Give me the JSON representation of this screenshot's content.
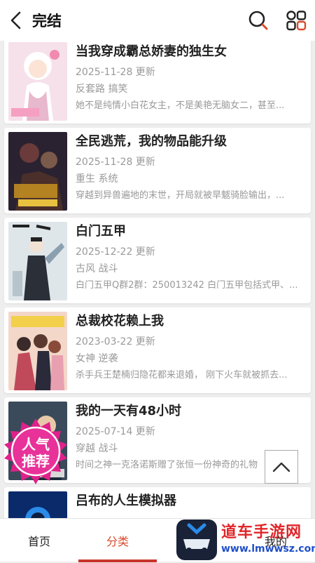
{
  "header": {
    "title": "完结",
    "back_icon": "chevron-left-icon",
    "search_icon": "search-icon",
    "menu_icon": "grid-menu-icon"
  },
  "comics": [
    {
      "title": "当我穿成霸总娇妻的独生女",
      "updated": "2025-11-28 更新",
      "tags": "反套路 搞笑",
      "desc": "她不是纯情小白花女主，不是美艳无脑女二，甚至..."
    },
    {
      "title": "全民逃荒，我的物品能升级",
      "updated": "2025-11-28 更新",
      "tags": "重生 系统",
      "desc": "穿越到异兽遍地的末世，开局就被旱魃骑脸输出，..."
    },
    {
      "title": "白门五甲",
      "updated": "2025-12-22 更新",
      "tags": "古风 战斗",
      "desc": "白门五甲Q群2群：250013242 白门五甲包括式甲、..."
    },
    {
      "title": "总裁校花赖上我",
      "updated": "2023-03-22 更新",
      "tags": "女神 逆袭",
      "desc": "杀手兵王楚楠归隐花都来退婚， 刚下火车就被抓去..."
    },
    {
      "title": "我的一天有48小时",
      "updated": "2025-07-14 更新",
      "tags": "穿越 战斗",
      "desc": "时间之神一克洛诺斯赠了张恒一份神奇的礼物"
    },
    {
      "title": "吕布的人生模拟器",
      "updated": "",
      "tags": "",
      "desc": ""
    }
  ],
  "badge": {
    "line1": "人气",
    "line2": "推荐"
  },
  "tabs": [
    {
      "label": "首页",
      "active": false
    },
    {
      "label": "分类",
      "active": true
    },
    {
      "label": "我的",
      "active": false
    }
  ],
  "watermark": {
    "line1": "道车手游网",
    "line2": "www.lmwwsz.com"
  },
  "colors": {
    "accent": "#d84a2c",
    "badge": "#e0218a"
  }
}
